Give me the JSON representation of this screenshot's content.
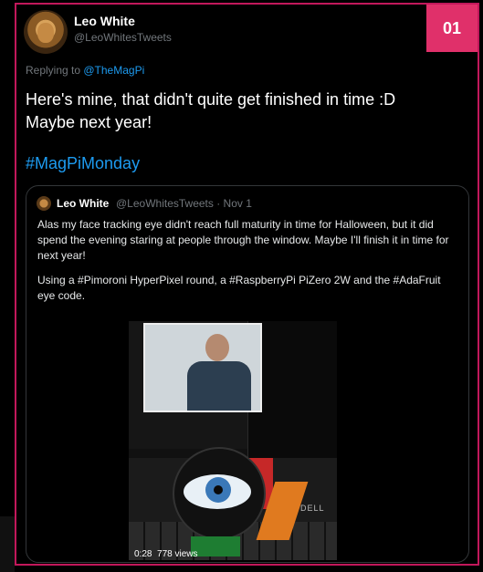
{
  "badge": "01",
  "tweet": {
    "author_name": "Leo White",
    "author_handle": "@LeoWhitesTweets",
    "replying_prefix": "Replying to ",
    "replying_mention": "@TheMagPi",
    "text_line1": "Here's mine, that didn't quite get finished in time :D",
    "text_line2": "Maybe next year!",
    "hashtag": "#MagPiMonday"
  },
  "quote": {
    "author_name": "Leo White",
    "meta": "@LeoWhitesTweets · Nov 1",
    "paragraph1": "Alas my face tracking eye didn't reach full maturity in time for Halloween, but it did spend the evening staring at people through the window. Maybe I'll finish it in time for next year!",
    "paragraph2": "Using a #Pimoroni HyperPixel round, a #RaspberryPi PiZero 2W and the #AdaFruit eye code.",
    "video_time": "0:28",
    "video_views": "778 views",
    "media_brand": "DELL"
  },
  "colors": {
    "accent": "#1d9bf0",
    "badge": "#e0306a",
    "frame": "#c2185b"
  }
}
